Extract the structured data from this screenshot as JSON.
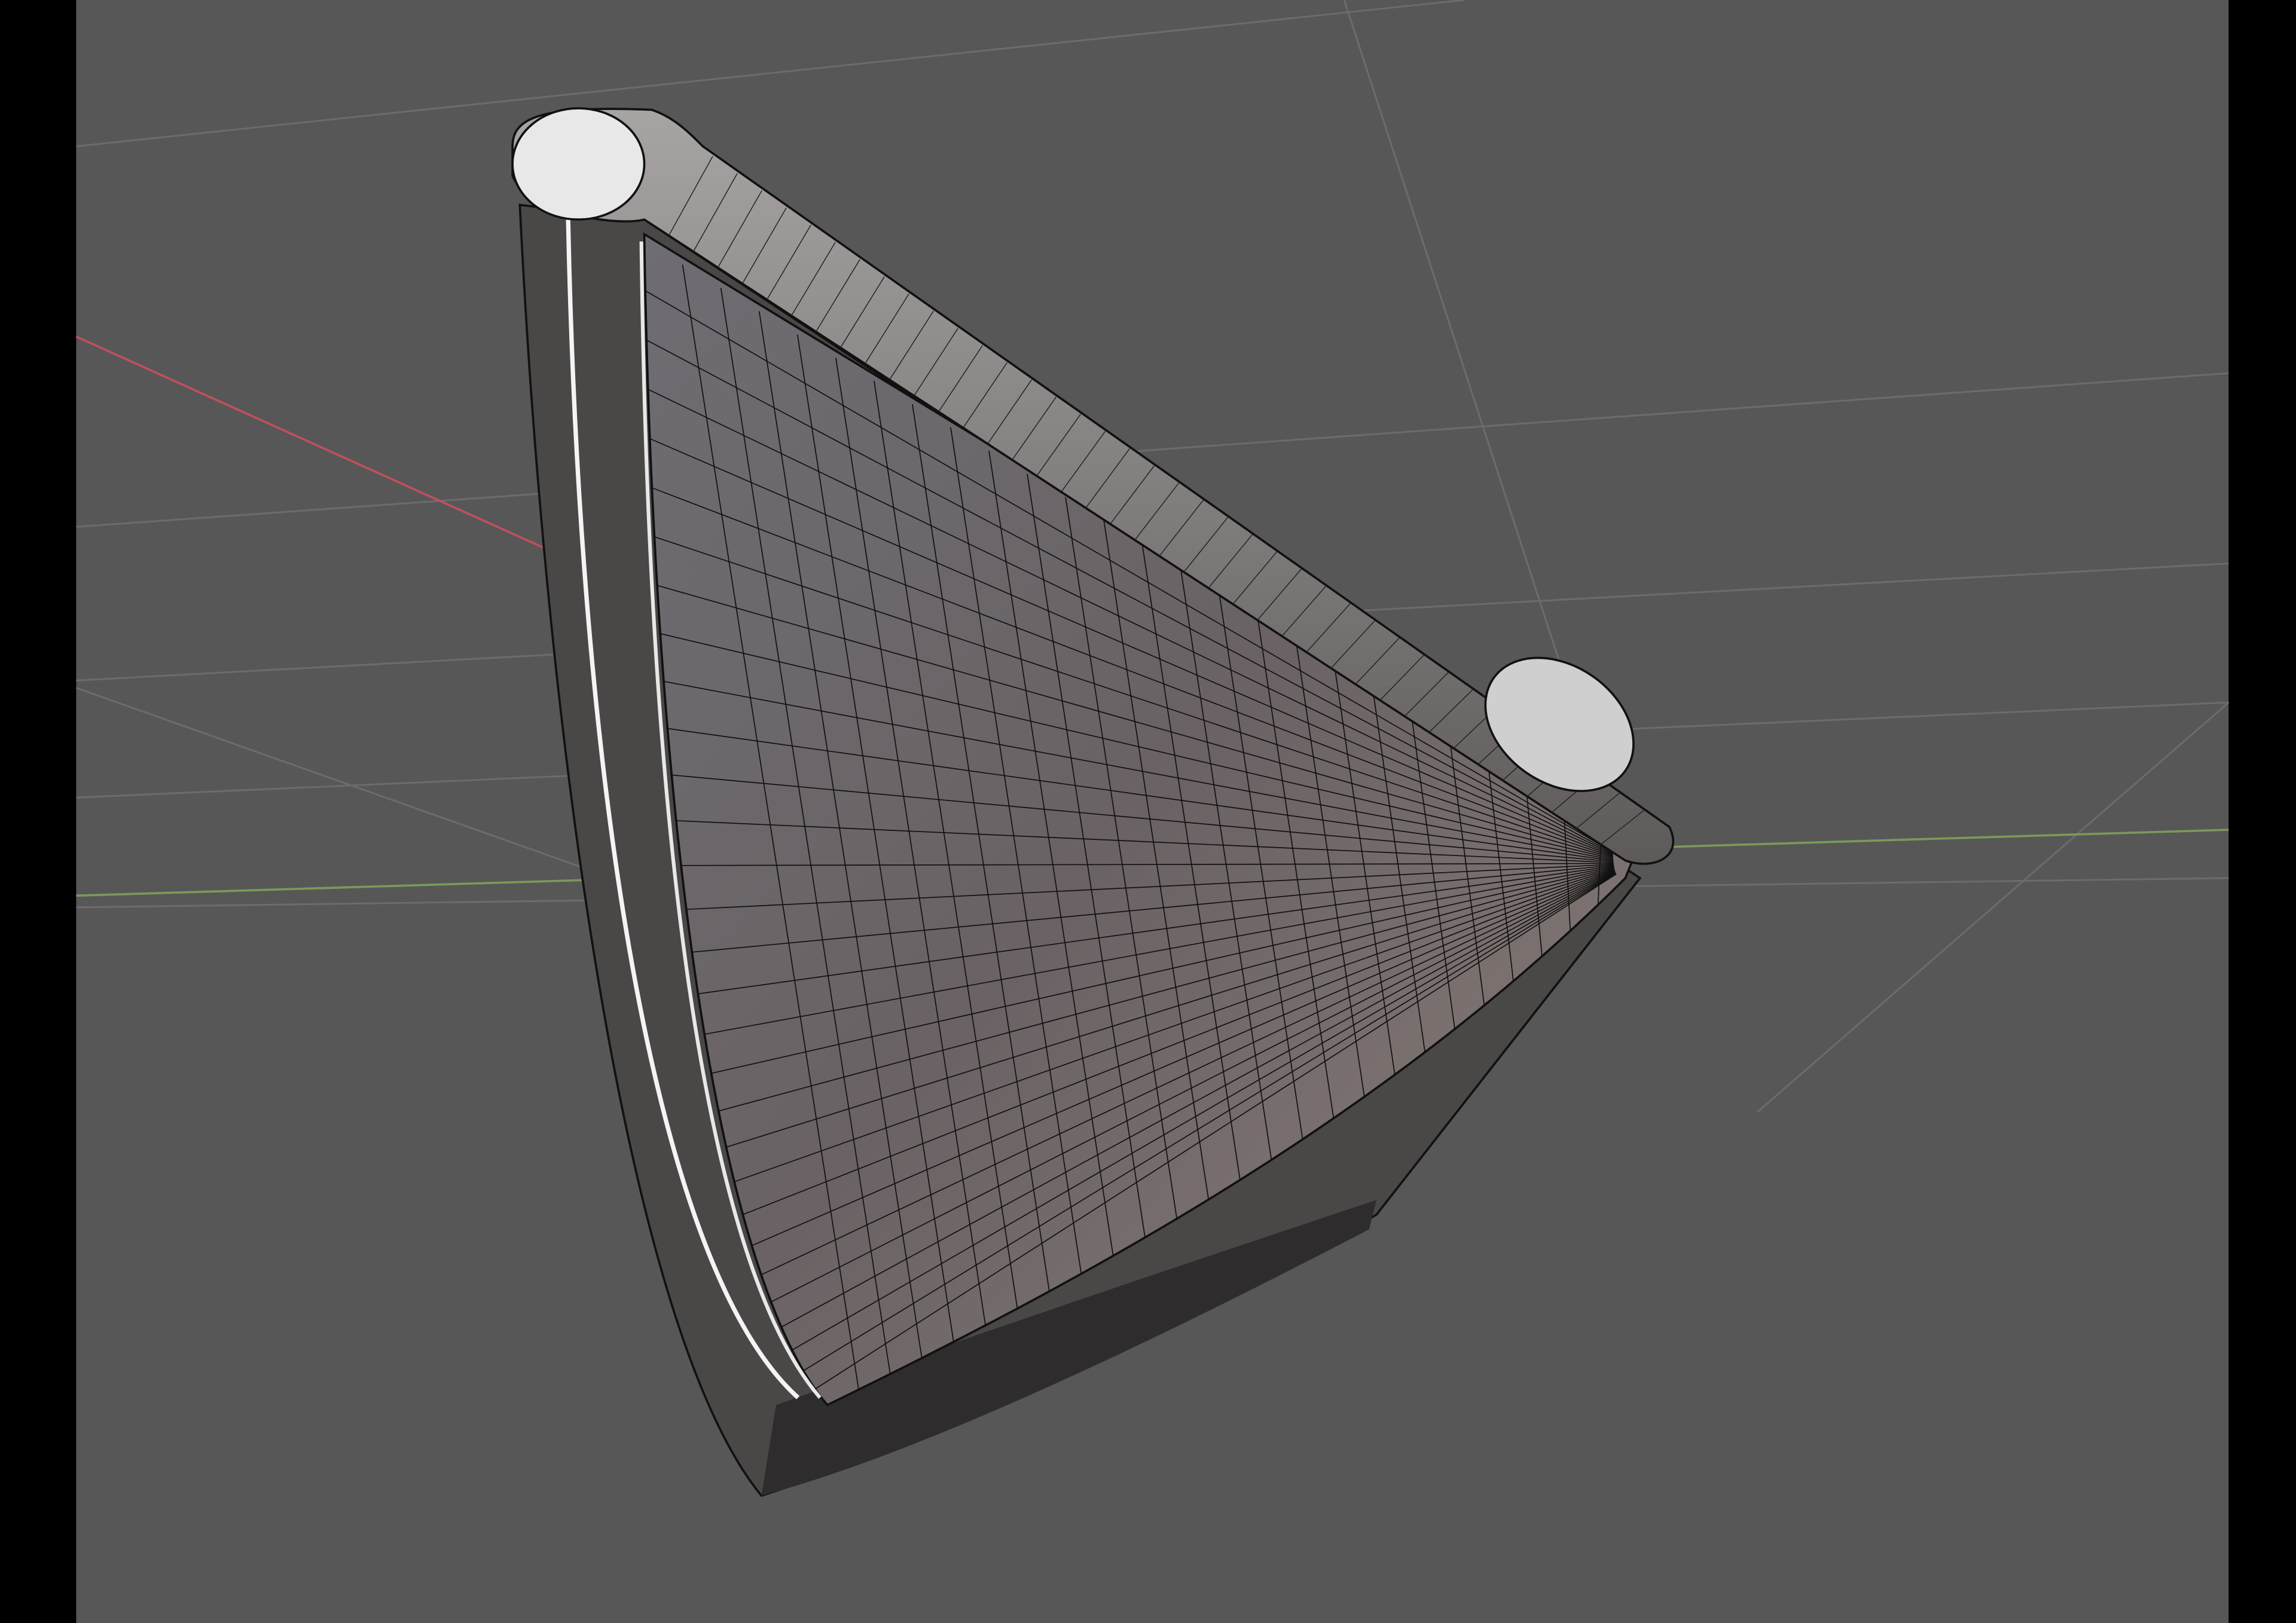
{
  "viewport": {
    "background_color": "#575757",
    "letterbox_color": "#000000",
    "grid_color": "#6a6a6a",
    "x_axis_color": "#c0505c",
    "y_axis_color": "#7a9a5a",
    "mesh_color": "#8a8282",
    "wire_color": "#111111"
  }
}
